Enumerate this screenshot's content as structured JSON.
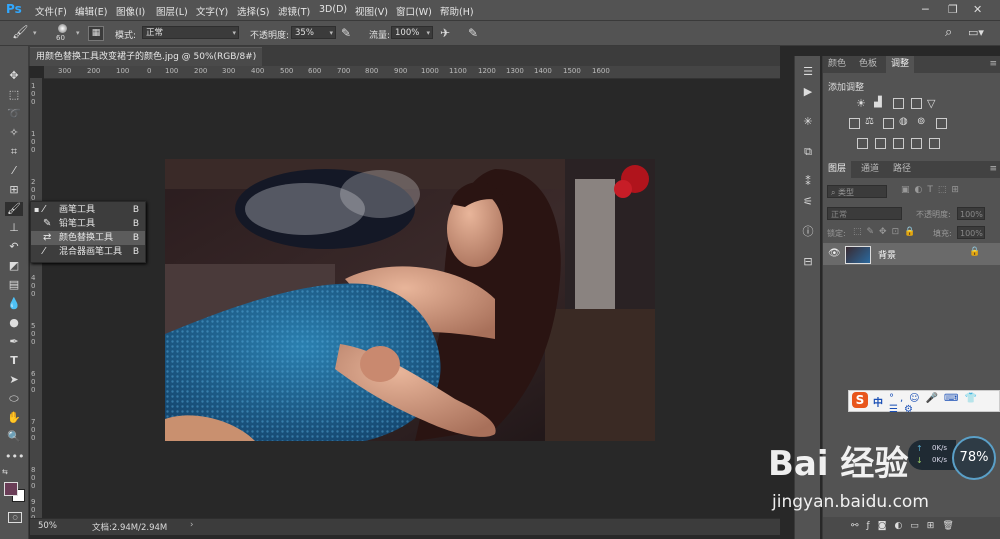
{
  "app": {
    "logo": "Ps"
  },
  "menu": [
    "文件(F)",
    "编辑(E)",
    "图像(I)",
    "图层(L)",
    "文字(Y)",
    "选择(S)",
    "滤镜(T)",
    "3D(D)",
    "视图(V)",
    "窗口(W)",
    "帮助(H)"
  ],
  "options": {
    "brush_size": "60",
    "mode_label": "模式:",
    "mode_value": "正常",
    "opacity_label": "不透明度:",
    "opacity_value": "35%",
    "flow_label": "流量:",
    "flow_value": "100%"
  },
  "document": {
    "tab_title": "用颜色替换工具改变裙子的颜色.jpg @ 50%(RGB/8#)"
  },
  "rulers": {
    "h": [
      "300",
      "200",
      "100",
      "0",
      "100",
      "200",
      "300",
      "400",
      "500",
      "600",
      "700",
      "800",
      "900",
      "1000",
      "1100",
      "1200",
      "1300",
      "1400",
      "1500",
      "1600"
    ],
    "v": [
      "1",
      "0",
      "0",
      "1",
      "0",
      "0",
      "2",
      "0",
      "0",
      "3",
      "0",
      "0",
      "4",
      "0",
      "0",
      "5",
      "0",
      "0",
      "6",
      "0",
      "0",
      "7",
      "0",
      "0",
      "8",
      "0",
      "0",
      "9",
      "0",
      "0"
    ]
  },
  "flyout": [
    {
      "label": "画笔工具",
      "key": "B"
    },
    {
      "label": "铅笔工具",
      "key": "B"
    },
    {
      "label": "颜色替换工具",
      "key": "B"
    },
    {
      "label": "混合器画笔工具",
      "key": "B"
    }
  ],
  "status": {
    "zoom": "50%",
    "doc": "文档:2.94M/2.94M"
  },
  "panels": {
    "top_tabs": [
      "颜色",
      "色板",
      "调整"
    ],
    "adjust_title": "添加调整",
    "layer_tabs": [
      "图层",
      "通道",
      "路径"
    ],
    "kind_label": "类型",
    "blend": "正常",
    "opacity_label": "不透明度:",
    "opacity_value": "100%",
    "lock_label": "锁定:",
    "fill_label": "填充:",
    "fill_value": "100%",
    "layer_name": "背景"
  },
  "overlay": {
    "ime_label": "中",
    "net_speed_up": "0K/s",
    "net_speed_down": "0K/s",
    "gauge": "78%",
    "watermark": "Bai 经验",
    "watermark_url": "jingyan.baidu.com"
  },
  "colors": {
    "accent": "#31a8ff",
    "chrome": "#535353",
    "canvas": "#282828"
  }
}
